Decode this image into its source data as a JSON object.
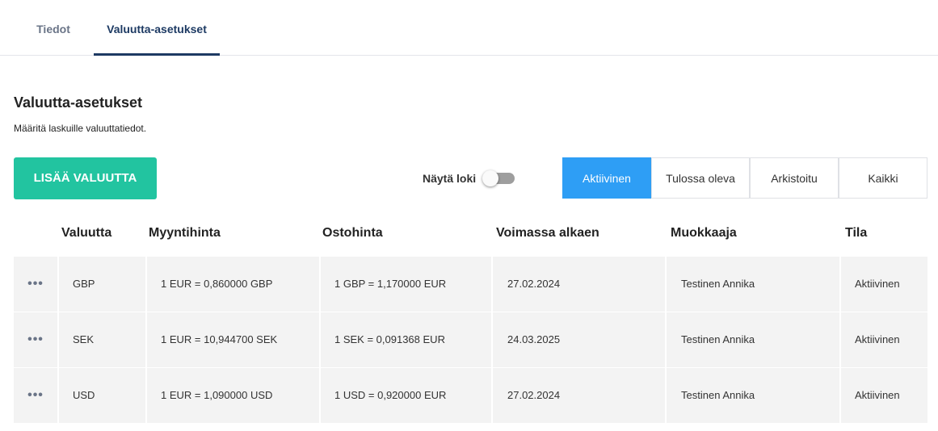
{
  "tabs": [
    {
      "label": "Tiedot"
    },
    {
      "label": "Valuutta-asetukset",
      "active": true
    }
  ],
  "section": {
    "title": "Valuutta-asetukset",
    "description": "Määritä laskuille valuuttatiedot."
  },
  "add_button_label": "LISÄÄ VALUUTTA",
  "log_toggle": {
    "label": "Näytä loki",
    "on": false
  },
  "filters": [
    {
      "label": "Aktiivinen",
      "active": true
    },
    {
      "label": "Tulossa oleva"
    },
    {
      "label": "Arkistoitu"
    },
    {
      "label": "Kaikki"
    }
  ],
  "table": {
    "columns": [
      "Valuutta",
      "Myyntihinta",
      "Ostohinta",
      "Voimassa alkaen",
      "Muokkaaja",
      "Tila"
    ],
    "rows": [
      {
        "menu": "•••",
        "currency": "GBP",
        "sell": "1 EUR = 0,860000 GBP",
        "buy": "1 GBP = 1,170000 EUR",
        "valid_from": "27.02.2024",
        "editor": "Testinen Annika",
        "status": "Aktiivinen"
      },
      {
        "menu": "•••",
        "currency": "SEK",
        "sell": "1 EUR = 10,944700 SEK",
        "buy": "1 SEK = 0,091368 EUR",
        "valid_from": "24.03.2025",
        "editor": "Testinen Annika",
        "status": "Aktiivinen"
      },
      {
        "menu": "•••",
        "currency": "USD",
        "sell": "1 EUR = 1,090000 USD",
        "buy": "1 USD = 0,920000 EUR",
        "valid_from": "27.02.2024",
        "editor": "Testinen Annika",
        "status": "Aktiivinen"
      }
    ]
  },
  "colors": {
    "accent_green": "#22c4a0",
    "accent_blue": "#2e9ef5",
    "tab_active": "#1d3a63",
    "row_bg": "#f3f3f3"
  }
}
